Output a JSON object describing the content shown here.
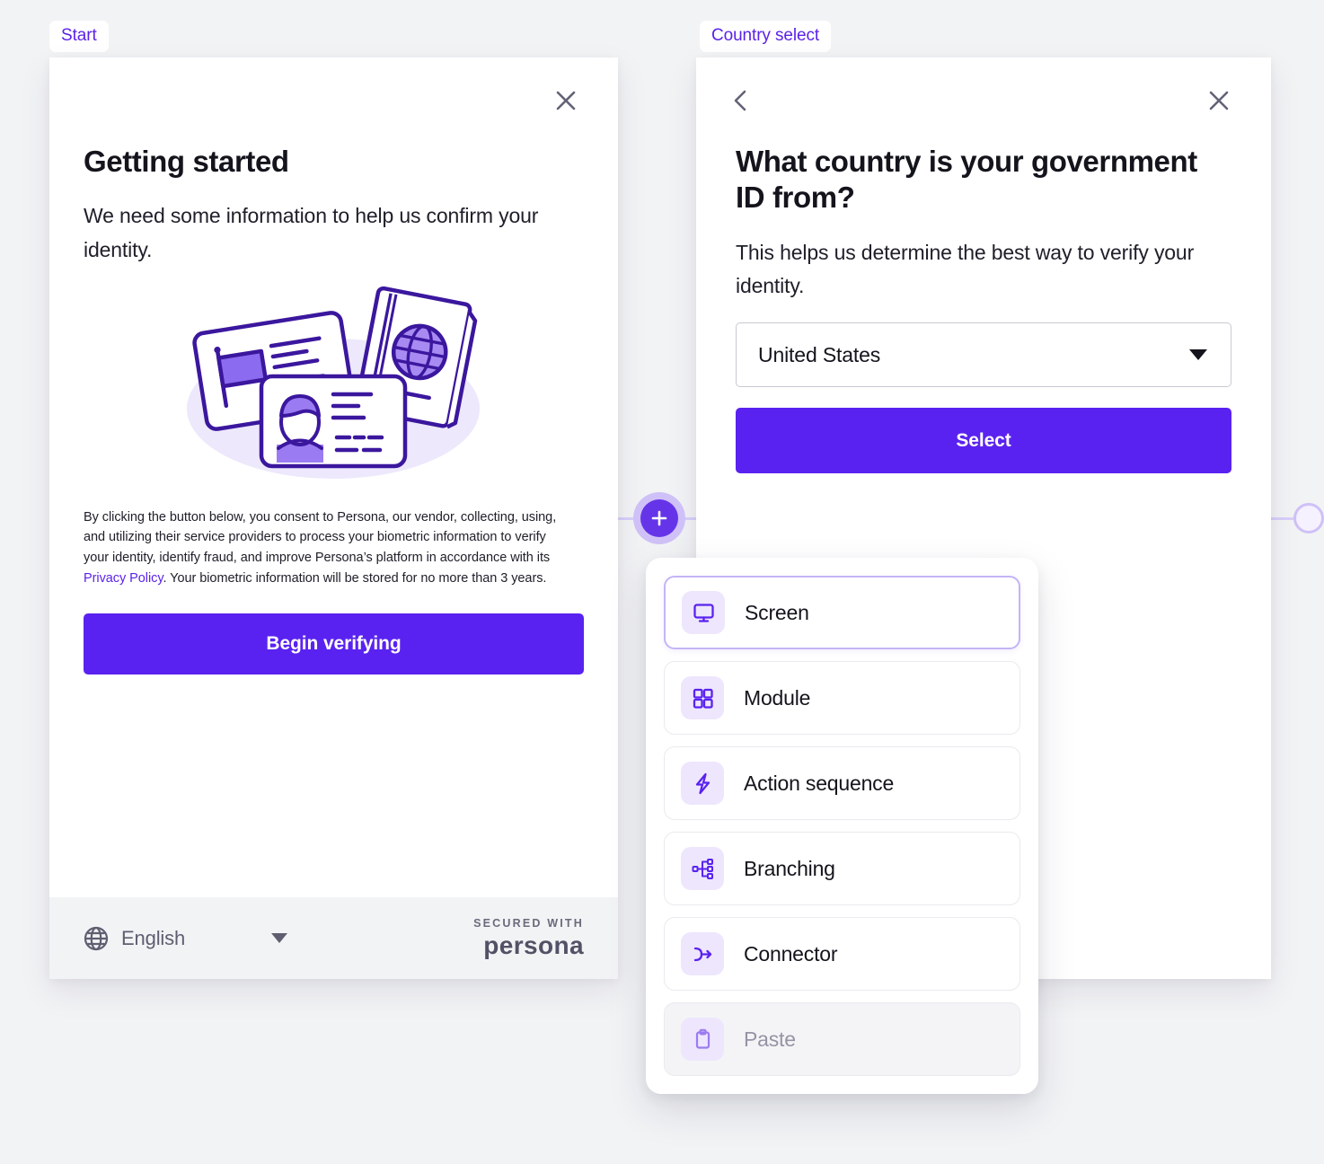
{
  "theme": {
    "accent": "#5A22F0",
    "accent_light": "#CFC1F7",
    "chip_text": "#5B22E8",
    "canvas_bg": "#F2F3F5",
    "card_bg": "#FFFFFF",
    "footer_bg": "#F2F3F5"
  },
  "steps": {
    "start_tab": "Start",
    "country_tab": "Country select"
  },
  "start_card": {
    "close_icon": "close-icon",
    "title": "Getting started",
    "subtitle": "We need some information to help us confirm your identity.",
    "illustration": "id-documents-illustration",
    "legal": {
      "part1": "By clicking the button below, you consent to Persona, our vendor, collecting, using, and utilizing their service providers to process your biometric information to verify your identity, identify fraud, and improve Persona’s platform in accordance with its ",
      "link": "Privacy Policy",
      "part2": ". Your biometric information will be stored for no more than 3 years."
    },
    "cta_label": "Begin verifying",
    "footer": {
      "globe_icon": "globe-icon",
      "language": "English",
      "caret_icon": "chevron-down-icon",
      "brand_tagline": "SECURED WITH",
      "brand_name": "persona"
    }
  },
  "country_card": {
    "back_icon": "chevron-left-icon",
    "close_icon": "close-icon",
    "title": "What country is your government ID from?",
    "subtitle": "This helps us determine the best way to verify your identity.",
    "select": {
      "value": "United States",
      "caret_icon": "chevron-down-icon"
    },
    "cta_label": "Select"
  },
  "add_menu": {
    "plus_icon": "plus-icon",
    "items": [
      {
        "label": "Screen",
        "icon": "monitor-icon",
        "selected": true,
        "disabled": false
      },
      {
        "label": "Module",
        "icon": "grid-icon",
        "selected": false,
        "disabled": false
      },
      {
        "label": "Action sequence",
        "icon": "lightning-icon",
        "selected": false,
        "disabled": false
      },
      {
        "label": "Branching",
        "icon": "branching-icon",
        "selected": false,
        "disabled": false
      },
      {
        "label": "Connector",
        "icon": "connector-icon",
        "selected": false,
        "disabled": false
      },
      {
        "label": "Paste",
        "icon": "clipboard-icon",
        "selected": false,
        "disabled": true
      }
    ]
  }
}
